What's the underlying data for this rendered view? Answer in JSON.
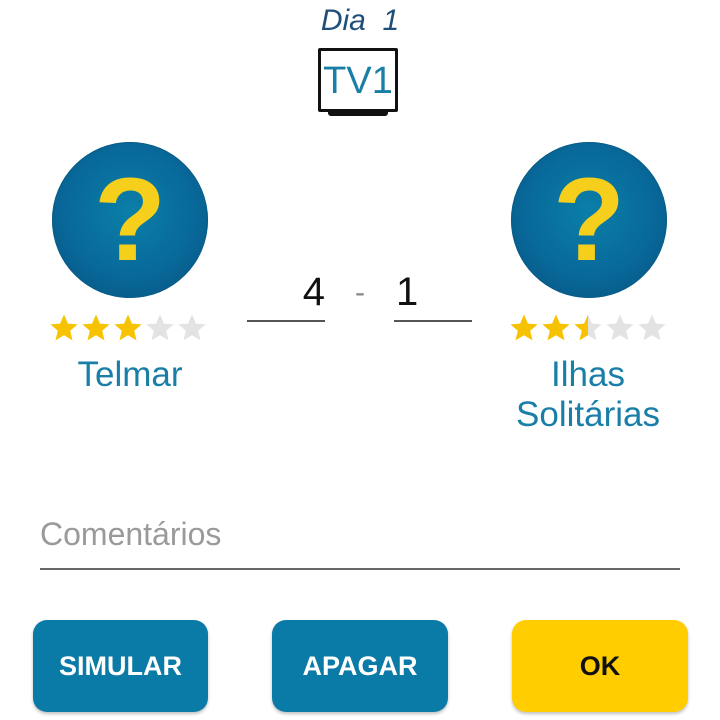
{
  "header": {
    "day_label": "Dia",
    "day_number": "1",
    "broadcast": "TV1"
  },
  "match": {
    "home": {
      "logo_placeholder": "?",
      "name": "Telmar",
      "rating": 3,
      "score": "4"
    },
    "separator": "-",
    "away": {
      "logo_placeholder": "?",
      "name_line1": "Ilhas",
      "name_line2": "Solitárias",
      "rating": 2.5,
      "score": "1"
    }
  },
  "comments": {
    "placeholder": "Comentários",
    "value": ""
  },
  "buttons": {
    "simulate": "SIMULAR",
    "clear": "APAGAR",
    "ok": "OK"
  },
  "colors": {
    "accent": "#0a7aa6",
    "team_text": "#1a7fa8",
    "logo_question": "#f5cf1c",
    "star_filled": "#f7c300",
    "star_empty": "#e3e3e3",
    "ok_button": "#ffcd00"
  },
  "icons": {
    "tv": "tv-icon",
    "star": "star-icon",
    "team_logo": "question-mark-icon"
  }
}
